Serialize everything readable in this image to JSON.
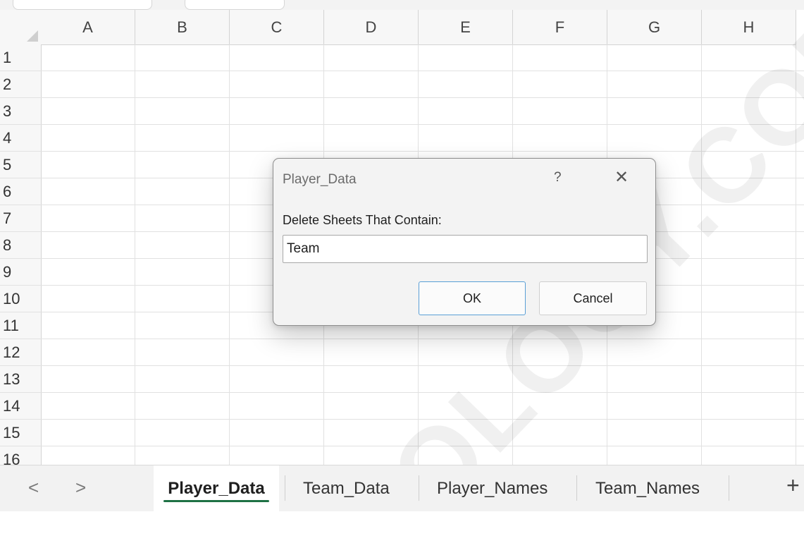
{
  "grid": {
    "columns": [
      "A",
      "B",
      "C",
      "D",
      "E",
      "F",
      "G",
      "H"
    ],
    "rows": [
      "1",
      "2",
      "3",
      "4",
      "5",
      "6",
      "7",
      "8",
      "9",
      "10",
      "11",
      "12",
      "13",
      "14",
      "15",
      "16"
    ]
  },
  "dialog": {
    "title": "Player_Data",
    "help": "?",
    "close": "✕",
    "label": "Delete Sheets That Contain:",
    "input_value": "Team",
    "ok_label": "OK",
    "cancel_label": "Cancel"
  },
  "sheet_tabs": {
    "prev": "<",
    "next": ">",
    "tabs": [
      "Player_Data",
      "Team_Data",
      "Player_Names",
      "Team_Names"
    ],
    "active_index": 0,
    "add": "+",
    "active_color": "#1e7145"
  },
  "watermark": "OLOGY.COM"
}
